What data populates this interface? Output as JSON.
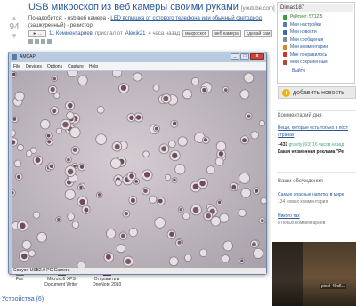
{
  "post": {
    "score": "94",
    "title": "USB микроскоп из веб камеры своими руками",
    "title_tag": "[youtube.com]",
    "line1_prefix": "Понадобится: - usb веб камера - ",
    "line1_link": "LED вспышка от сотового телефона или обычный светодиод",
    "line2": "(зашкуренный) - резистор",
    "play_label": "► ...",
    "comments_link": "11 Комментариев",
    "posted_prefix": "прислал от",
    "author": "Alexik21",
    "time": "4 часа назад",
    "tags": [
      "микроскоп",
      "веб камера",
      "сделай сам"
    ]
  },
  "user_menu": {
    "username": "Dimas187",
    "items": [
      {
        "label": "Рейтинг: 5712.5",
        "icon": "rating-icon",
        "color": "#3a9a3a"
      },
      {
        "label": "Мои настройки",
        "icon": "settings-icon",
        "color": "#5a7ab0"
      },
      {
        "label": "Мои новости",
        "icon": "news-icon",
        "color": "#3a6ab0"
      },
      {
        "label": "Мои сообщения",
        "icon": "messages-icon",
        "color": "#7a8a9a"
      },
      {
        "label": "Мои комментарии",
        "icon": "comments-icon",
        "color": "#d08a20"
      },
      {
        "label": "Мне понравилось",
        "icon": "heart-icon",
        "color": "#d03030"
      },
      {
        "label": "Мои сохраненные",
        "icon": "saved-icon",
        "color": "#b04a30"
      }
    ],
    "logout": "Выйти"
  },
  "add_news": "добавить новость",
  "comment_of_day": {
    "heading": "Комментарий дня",
    "link1": "Вещи, которые есть только в пост",
    "link2": "странах",
    "votes": "+431",
    "votes_meta": "gravity (63) 16 часов назад",
    "bold_line": "Какая низменная реклама \"Ре"
  },
  "discussions": {
    "heading": "Ваши обсуждения",
    "item1_link": "Самые опасные напитки в мире",
    "item1_meta": "134 новых комментария",
    "item2_link": "Никого так",
    "item2_meta": "8 новых комментариев"
  },
  "amcap": {
    "title": "AMCAP",
    "menu": [
      "File",
      "Devices",
      "Options",
      "Capture",
      "Help"
    ],
    "status": "Conyon USB2.0 PC Camera"
  },
  "taskbar": [
    {
      "label": "Fax",
      "icon_color": "#888888"
    },
    {
      "label": "Microsoft XPS Document Writer",
      "icon_color": "#666666"
    },
    {
      "label": "Отправить в OneNote 2010",
      "icon_color": "#6a3a8a"
    }
  ],
  "devices_label": "Устройства (6)",
  "thumb_label": "pixel-49c5..."
}
